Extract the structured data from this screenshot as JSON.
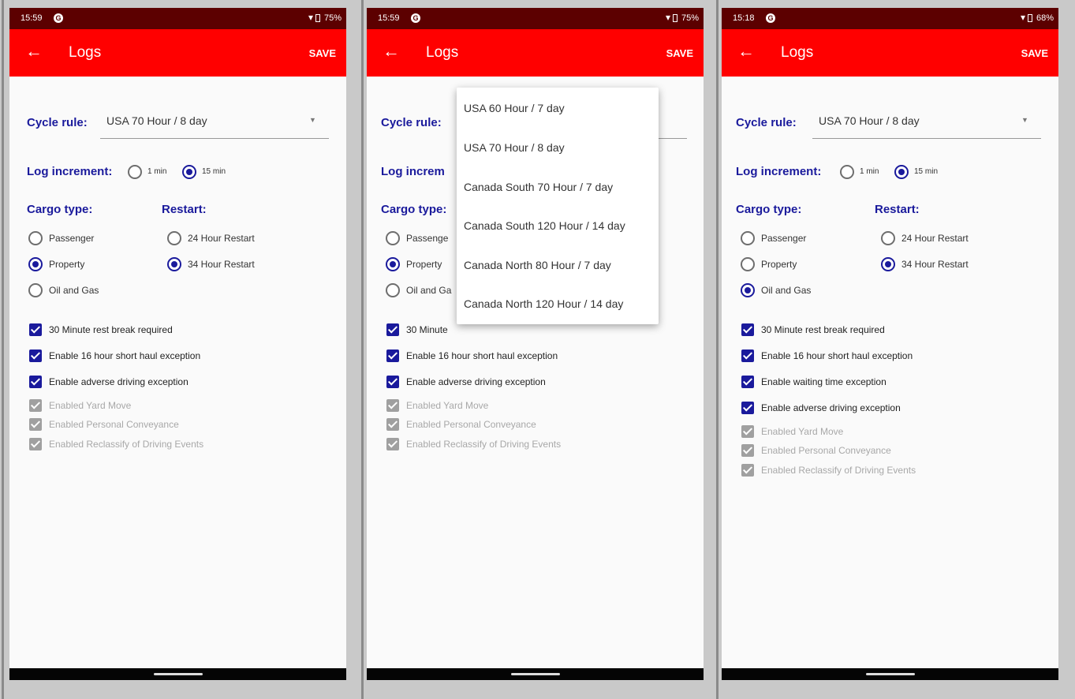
{
  "app": {
    "title": "Logs",
    "save_label": "SAVE",
    "back_icon": "arrow-left-icon"
  },
  "colors": {
    "appbar": "#ff0000",
    "statusbar": "#5c0000",
    "accent": "#1a1a9c",
    "disabled": "#a0a0a0"
  },
  "labels": {
    "cycle_rule": "Cycle rule:",
    "log_increment": "Log increment:",
    "cargo_type": "Cargo type:",
    "restart": "Restart:",
    "inc_1min": "1 min",
    "inc_15min": "15 min",
    "passenger": "Passenger",
    "property": "Property",
    "oil_gas": "Oil and Gas",
    "restart_24": "24 Hour Restart",
    "restart_34": "34 Hour Restart"
  },
  "screens": [
    {
      "status": {
        "time": "15:59",
        "battery": "75%"
      },
      "cycle_rule": "USA 70 Hour / 8 day",
      "log_increment": "15 min",
      "cargo_type": "Property",
      "restart": "34 Hour Restart",
      "checkboxes": [
        {
          "label": "30 Minute rest break required",
          "checked": true,
          "enabled": true
        },
        {
          "label": "Enable 16 hour short haul exception",
          "checked": true,
          "enabled": true
        },
        {
          "label": "Enable adverse driving exception",
          "checked": true,
          "enabled": true
        },
        {
          "label": "Enabled Yard Move",
          "checked": true,
          "enabled": false
        },
        {
          "label": "Enabled Personal Conveyance",
          "checked": true,
          "enabled": false
        },
        {
          "label": "Enabled Reclassify of Driving Events",
          "checked": true,
          "enabled": false
        }
      ]
    },
    {
      "status": {
        "time": "15:59",
        "battery": "75%"
      },
      "log_increment_truncated": "Log increm",
      "cargo_truncated": {
        "passenger": "Passenge",
        "property": "Property",
        "oil_gas": "Oil and Ga"
      },
      "checkbox_first_truncated": "30 Minute",
      "dropdown_options": [
        "USA 60 Hour / 7 day",
        "USA 70 Hour / 8 day",
        "Canada South 70 Hour / 7 day",
        "Canada South 120 Hour / 14 day",
        "Canada North 80 Hour / 7 day",
        "Canada North 120 Hour / 14 day"
      ],
      "checkboxes": [
        {
          "label": "Enable 16 hour short haul exception",
          "checked": true,
          "enabled": true
        },
        {
          "label": "Enable adverse driving exception",
          "checked": true,
          "enabled": true
        },
        {
          "label": "Enabled Yard Move",
          "checked": true,
          "enabled": false
        },
        {
          "label": "Enabled Personal Conveyance",
          "checked": true,
          "enabled": false
        },
        {
          "label": "Enabled Reclassify of Driving Events",
          "checked": true,
          "enabled": false
        }
      ]
    },
    {
      "status": {
        "time": "15:18",
        "battery": "68%"
      },
      "cycle_rule": "USA 70 Hour / 8 day",
      "log_increment": "15 min",
      "cargo_type": "Oil and Gas",
      "restart": "34 Hour Restart",
      "checkboxes": [
        {
          "label": "30 Minute rest break required",
          "checked": true,
          "enabled": true
        },
        {
          "label": "Enable 16 hour short haul exception",
          "checked": true,
          "enabled": true
        },
        {
          "label": "Enable waiting time exception",
          "checked": true,
          "enabled": true
        },
        {
          "label": "Enable adverse driving exception",
          "checked": true,
          "enabled": true
        },
        {
          "label": "Enabled Yard Move",
          "checked": true,
          "enabled": false
        },
        {
          "label": "Enabled Personal Conveyance",
          "checked": true,
          "enabled": false
        },
        {
          "label": "Enabled Reclassify of Driving Events",
          "checked": true,
          "enabled": false
        }
      ]
    }
  ]
}
